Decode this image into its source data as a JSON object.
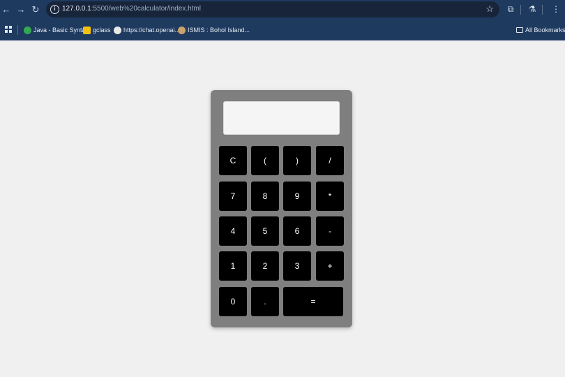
{
  "browser": {
    "url_host": "127.0.0.1",
    "url_path": ":5500/web%20calculator/index.html",
    "bookmarks": [
      {
        "label": "Java - Basic Syntax",
        "color": "#34a853"
      },
      {
        "label": "gclass",
        "color": "#f4c20d"
      },
      {
        "label": "https://chat.openai....",
        "color": "#e8e8e8"
      },
      {
        "label": "ISMIS : Bohol Island...",
        "color": "#c9a36b"
      }
    ],
    "all_bookmarks": "All Bookmarks"
  },
  "calculator": {
    "display_value": "",
    "keys": {
      "clear": "C",
      "open_paren": "(",
      "close_paren": ")",
      "divide": "/",
      "seven": "7",
      "eight": "8",
      "nine": "9",
      "multiply": "*",
      "four": "4",
      "five": "5",
      "six": "6",
      "subtract": "-",
      "one": "1",
      "two": "2",
      "three": "3",
      "add": "+",
      "zero": "0",
      "decimal": ".",
      "equals": "="
    }
  }
}
